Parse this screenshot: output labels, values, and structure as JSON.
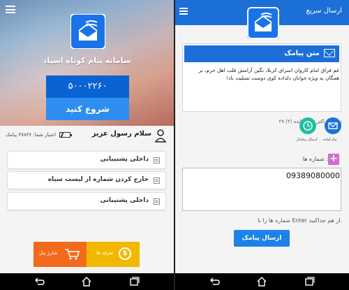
{
  "left": {
    "brand_text": "سامانه پیام کوتاه اسپاد",
    "line_number": "۵۰۰۰۲۲۶۰",
    "start_label": "شروع کنید",
    "greeting": "سلام رسول عزیز",
    "credit": "اعتبار شما: ۴۷۸۳۶ پیامک",
    "menu_items": [
      {
        "label": "داخلی پشتیبانی"
      },
      {
        "label": "خارج کردن شماره از لیست سیاه"
      },
      {
        "label": "داخلی پشتیبانی"
      }
    ],
    "footer": {
      "pay_label": "تعرفه ها",
      "charge_label": "شارژ پنل"
    }
  },
  "right": {
    "title": "ارسال سریع",
    "message_header": "متن پیامک",
    "message_text": "غم فراق امام کاروان اسرای کربلا، نگین آرامش قلب اهل حرم، بر همگان به ویژه جوانان دلداده کوی دوست تسلیت باد!",
    "char_count": "تعداد کاراکتر باقی مانده (۲) ۲۷",
    "circle_labels": [
      "پیام آماده",
      "ارسال زماندار"
    ],
    "numbers_label": "شماره ها :",
    "number_value": "09389080000",
    "hint": "شماره ها را با Enter از هم جداکنید.",
    "send_label": "ارسال پیامک"
  },
  "colors": {
    "primary_blue": "#1c6fd6",
    "orange": "#f26a1b",
    "yellow": "#f2b800",
    "teal": "#1dbfa0",
    "pink": "#d26bd0"
  }
}
